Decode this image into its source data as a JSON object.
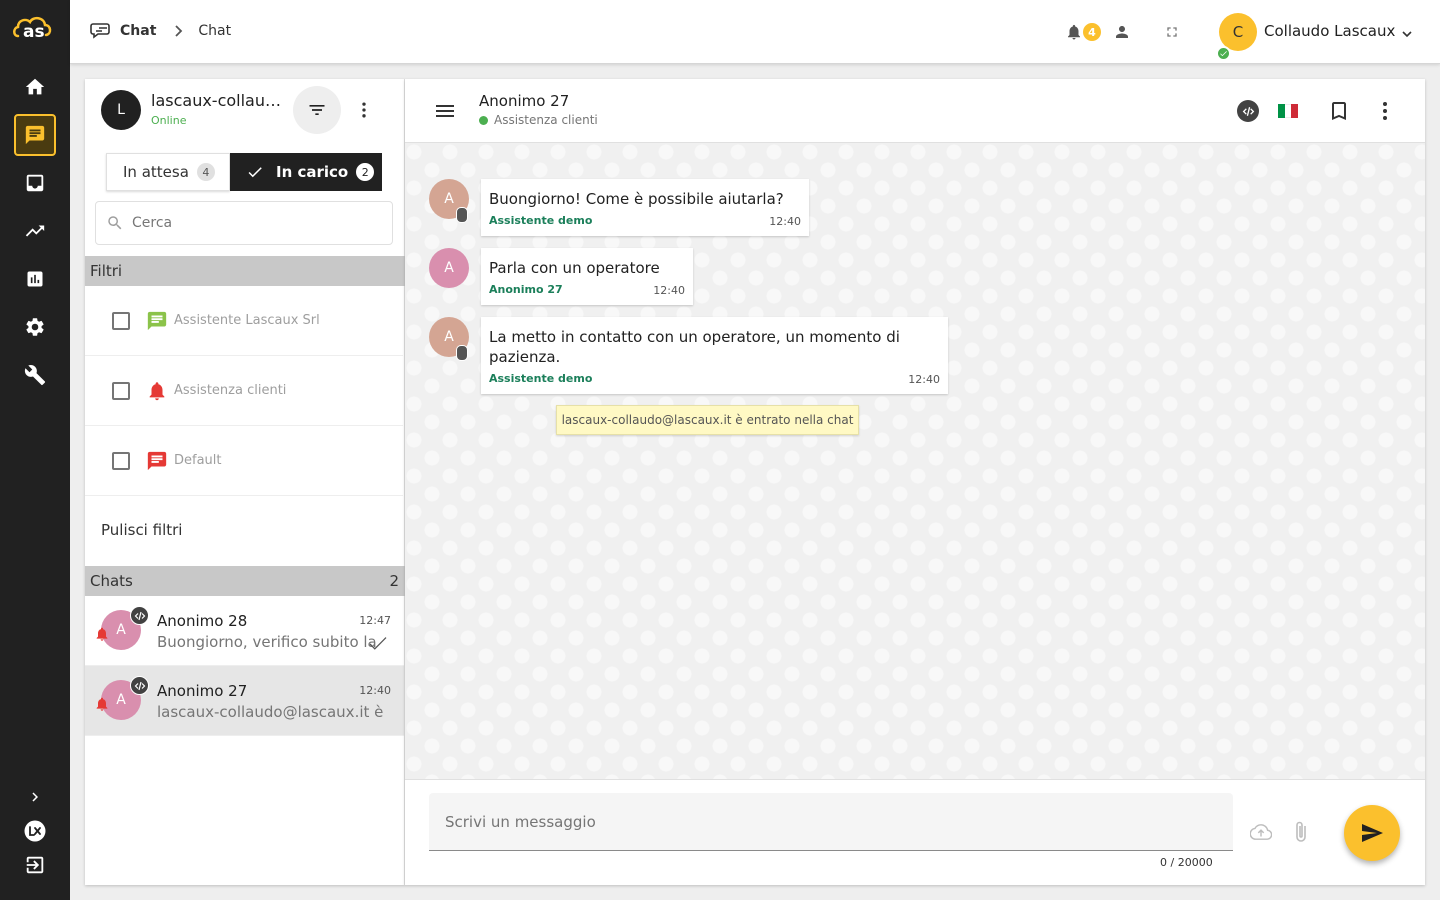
{
  "rail": {
    "logo_text": "as",
    "items": [
      {
        "icon": "home-icon"
      },
      {
        "icon": "chat-icon",
        "active": true
      },
      {
        "icon": "inbox-icon"
      },
      {
        "icon": "trending-icon"
      },
      {
        "icon": "bar-chart-icon"
      },
      {
        "icon": "gear-icon"
      },
      {
        "icon": "wrench-icon"
      }
    ],
    "bottom": [
      {
        "icon": "chevron-right-icon"
      },
      {
        "icon": "lx-logo-icon"
      },
      {
        "icon": "logout-icon"
      }
    ]
  },
  "topbar": {
    "breadcrumb": [
      "Chat",
      "Chat"
    ],
    "notifications_count": "4",
    "user": {
      "initial": "C",
      "name": "Collaudo Lascaux"
    }
  },
  "left": {
    "me": {
      "initial": "L",
      "name": "lascaux-collaudo@lascaux.it",
      "status": "Online"
    },
    "tabs": {
      "waiting": {
        "label": "In attesa",
        "count": "4"
      },
      "handling": {
        "label": "In carico",
        "count": "2"
      }
    },
    "search": {
      "placeholder": "Cerca"
    },
    "filters": {
      "title": "Filtri",
      "items": [
        {
          "label": "Assistente Lascaux Srl",
          "icon_color": "#8bc34a"
        },
        {
          "label": "Assistenza clienti",
          "icon_color": "#e53935"
        },
        {
          "label": "Default",
          "icon_color": "#e53935"
        }
      ],
      "clear_label": "Pulisci filtri"
    },
    "chats": {
      "title": "Chats",
      "count": "2",
      "items": [
        {
          "initial": "A",
          "name": "Anonimo 28",
          "time": "12:47",
          "preview": "Buongiorno, verifico subito la"
        },
        {
          "initial": "A",
          "name": "Anonimo 27",
          "time": "12:40",
          "preview": "lascaux-collaudo@lascaux.it è",
          "selected": true
        }
      ]
    }
  },
  "chat": {
    "name": "Anonimo 27",
    "department": "Assistenza clienti",
    "flag_colors": [
      "#009246",
      "#ffffff",
      "#ce2b37"
    ],
    "messages": [
      {
        "initial": "A",
        "kind": "bot",
        "text": "Buongiorno! Come è possibile aiutarla?",
        "sender": "Assistente demo",
        "time": "12:40"
      },
      {
        "initial": "A",
        "kind": "user",
        "text": "Parla con un operatore",
        "sender": "Anonimo 27",
        "time": "12:40"
      },
      {
        "initial": "A",
        "kind": "bot",
        "text": "La metto in contatto con un operatore, un momento di pazienza.",
        "sender": "Assistente demo",
        "time": "12:40"
      }
    ],
    "system_message": "lascaux-collaudo@lascaux.it è entrato nella chat",
    "composer": {
      "placeholder": "Scrivi un messaggio",
      "counter": "0 / 20000"
    }
  },
  "colors": {
    "accent": "#fbc02d",
    "rail": "#212121",
    "online": "#4caf50",
    "sender": "#1b7f5a"
  }
}
